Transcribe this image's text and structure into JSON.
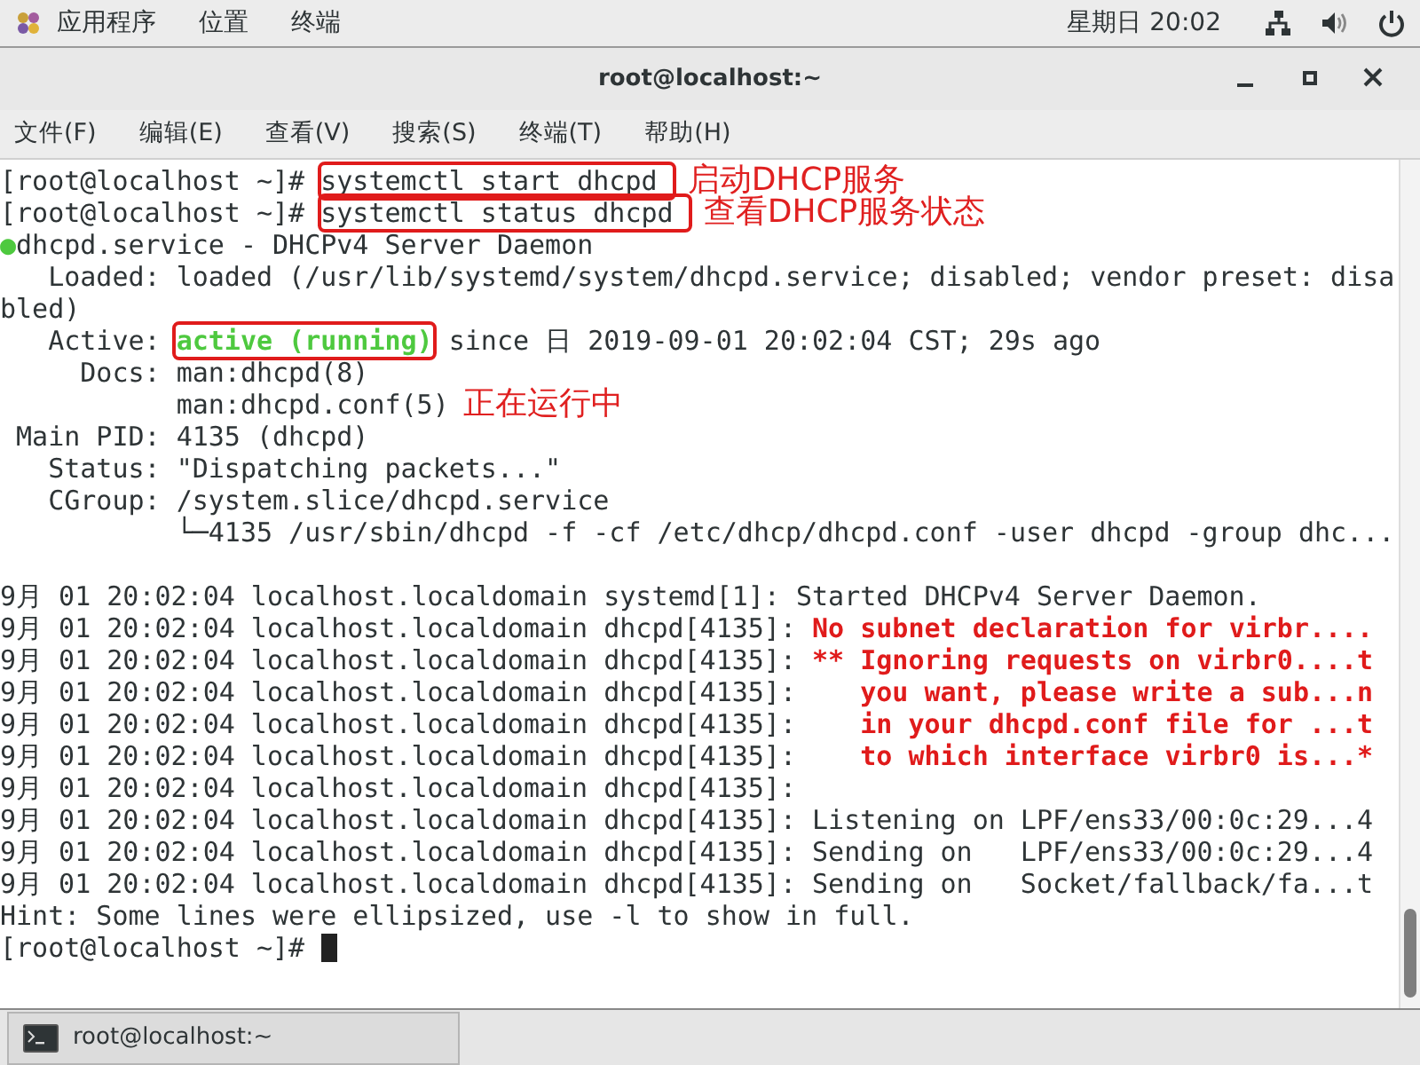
{
  "top_bar": {
    "menus": [
      "应用程序",
      "位置",
      "终端"
    ],
    "clock": "星期日 20:02"
  },
  "window": {
    "title": "root@localhost:~",
    "menu": [
      "文件(F)",
      "编辑(E)",
      "查看(V)",
      "搜索(S)",
      "终端(T)",
      "帮助(H)"
    ]
  },
  "terminal": {
    "lines": [
      {
        "segments": [
          {
            "text": "[root@localhost ~]# ",
            "kind": "normal"
          },
          {
            "text": "systemctl start dhcpd ",
            "kind": "normal",
            "boxed": true
          }
        ],
        "annotation": "启动DHCP服务"
      },
      {
        "segments": [
          {
            "text": "[root@localhost ~]# ",
            "kind": "normal"
          },
          {
            "text": "systemctl status dhcpd ",
            "kind": "normal",
            "boxed": true
          }
        ],
        "annotation": "查看DHCP服务状态"
      },
      {
        "segments": [
          {
            "text": "●",
            "kind": "green"
          },
          {
            "text": "dhcpd.service - DHCPv4 Server Daemon",
            "kind": "normal"
          }
        ]
      },
      {
        "segments": [
          {
            "text": "   Loaded: loaded (/usr/lib/systemd/system/dhcpd.service; disabled; vendor preset: disa",
            "kind": "normal"
          }
        ]
      },
      {
        "segments": [
          {
            "text": "bled)",
            "kind": "normal"
          }
        ]
      },
      {
        "segments": [
          {
            "text": "   Active: ",
            "kind": "normal"
          },
          {
            "text": "active (running)",
            "kind": "green",
            "boxed": true
          },
          {
            "text": " since 日 2019-09-01 20:02:04 CST; 29s ago",
            "kind": "normal"
          }
        ]
      },
      {
        "segments": [
          {
            "text": "     Docs: man:dhcpd(8)",
            "kind": "normal"
          }
        ]
      },
      {
        "segments": [
          {
            "text": "           man:dhcpd.conf(5)",
            "kind": "normal"
          }
        ],
        "annotation": "正在运行中"
      },
      {
        "segments": [
          {
            "text": " Main PID: 4135 (dhcpd)",
            "kind": "normal"
          }
        ]
      },
      {
        "segments": [
          {
            "text": "   Status: \"Dispatching packets...\"",
            "kind": "normal"
          }
        ]
      },
      {
        "segments": [
          {
            "text": "   CGroup: /system.slice/dhcpd.service",
            "kind": "normal"
          }
        ]
      },
      {
        "segments": [
          {
            "text": "           └─4135 /usr/sbin/dhcpd -f -cf /etc/dhcp/dhcpd.conf -user dhcpd -group dhc...",
            "kind": "normal"
          }
        ]
      }
    ],
    "journal": [
      {
        "segments": [
          {
            "text": "9月 01 20:02:04 localhost.localdomain systemd[1]: Started DHCPv4 Server Daemon.",
            "kind": "normal"
          }
        ]
      },
      {
        "segments": [
          {
            "text": "9月 01 20:02:04 localhost.localdomain dhcpd[4135]: ",
            "kind": "normal"
          },
          {
            "text": "No subnet declaration for virbr....",
            "kind": "red"
          }
        ]
      },
      {
        "segments": [
          {
            "text": "9月 01 20:02:04 localhost.localdomain dhcpd[4135]: ",
            "kind": "normal"
          },
          {
            "text": "** Ignoring requests on virbr0....t",
            "kind": "red"
          }
        ]
      },
      {
        "segments": [
          {
            "text": "9月 01 20:02:04 localhost.localdomain dhcpd[4135]: ",
            "kind": "normal"
          },
          {
            "text": "   you want, please write a sub...n",
            "kind": "red"
          }
        ]
      },
      {
        "segments": [
          {
            "text": "9月 01 20:02:04 localhost.localdomain dhcpd[4135]: ",
            "kind": "normal"
          },
          {
            "text": "   in your dhcpd.conf file for ...t",
            "kind": "red"
          }
        ]
      },
      {
        "segments": [
          {
            "text": "9月 01 20:02:04 localhost.localdomain dhcpd[4135]: ",
            "kind": "normal"
          },
          {
            "text": "   to which interface virbr0 is...*",
            "kind": "red"
          }
        ]
      },
      {
        "segments": [
          {
            "text": "9月 01 20:02:04 localhost.localdomain dhcpd[4135]:",
            "kind": "normal"
          }
        ]
      },
      {
        "segments": [
          {
            "text": "9月 01 20:02:04 localhost.localdomain dhcpd[4135]: Listening on LPF/ens33/00:0c:29...4",
            "kind": "normal"
          }
        ]
      },
      {
        "segments": [
          {
            "text": "9月 01 20:02:04 localhost.localdomain dhcpd[4135]: Sending on   LPF/ens33/00:0c:29...4",
            "kind": "normal"
          }
        ]
      },
      {
        "segments": [
          {
            "text": "9月 01 20:02:04 localhost.localdomain dhcpd[4135]: Sending on   Socket/fallback/fa...t",
            "kind": "normal"
          }
        ]
      },
      {
        "segments": [
          {
            "text": "Hint: Some lines were ellipsized, use -l to show in full.",
            "kind": "normal"
          }
        ]
      },
      {
        "segments": [
          {
            "text": "[root@localhost ~]# ",
            "kind": "normal"
          }
        ],
        "cursor": true
      }
    ]
  },
  "taskbar": {
    "items": [
      "root@localhost:~"
    ]
  }
}
